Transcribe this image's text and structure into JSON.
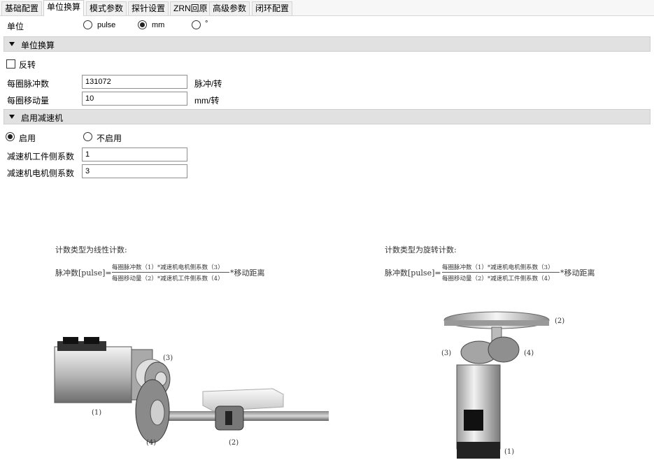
{
  "tabs": [
    {
      "label": "基础配置"
    },
    {
      "label": "单位换算"
    },
    {
      "label": "模式参数"
    },
    {
      "label": "探针设置"
    },
    {
      "label": "ZRN回原"
    },
    {
      "label": "高级参数"
    },
    {
      "label": "闭环配置"
    }
  ],
  "active_tab": "单位换算",
  "unit": {
    "label": "单位",
    "options": [
      {
        "label": "pulse",
        "checked": false
      },
      {
        "label": "mm",
        "checked": true
      },
      {
        "label": "°",
        "checked": false
      }
    ]
  },
  "conversion_section": {
    "title": "单位换算",
    "reverse_label": "反转",
    "reverse_checked": false,
    "pulses_per_rev": {
      "label": "每圈脉冲数",
      "value": "131072",
      "unit": "脉冲/转"
    },
    "move_per_rev": {
      "label": "每圈移动量",
      "value": "10",
      "unit": "mm/转"
    }
  },
  "reducer_section": {
    "title": "启用减速机",
    "enable_label": "启用",
    "disable_label": "不启用",
    "enabled": true,
    "workpiece_factor": {
      "label": "减速机工件侧系数",
      "value": "1"
    },
    "motor_factor": {
      "label": "减速机电机侧系数",
      "value": "3"
    }
  },
  "diagram_linear": {
    "caption": "计数类型为线性计数:",
    "lhs": "脉冲数[pulse]=",
    "numerator": "每圈脉冲数（1）*减速机电机侧系数（3）",
    "denominator": "每圈移动量（2）*减速机工件侧系数（4）",
    "rhs": "*移动距离",
    "callouts": [
      "(3)",
      "(1)",
      "(4)",
      "(2)"
    ]
  },
  "diagram_rotary": {
    "caption": "计数类型为旋转计数:",
    "lhs": "脉冲数[pulse]=",
    "numerator": "每圈脉冲数（1）*减速机电机侧系数（3）",
    "denominator": "每圈移动量（2）*减速机工件侧系数（4）",
    "rhs": "*移动距离",
    "callouts": [
      "(2)",
      "(3)",
      "(4)",
      "(1)"
    ]
  }
}
